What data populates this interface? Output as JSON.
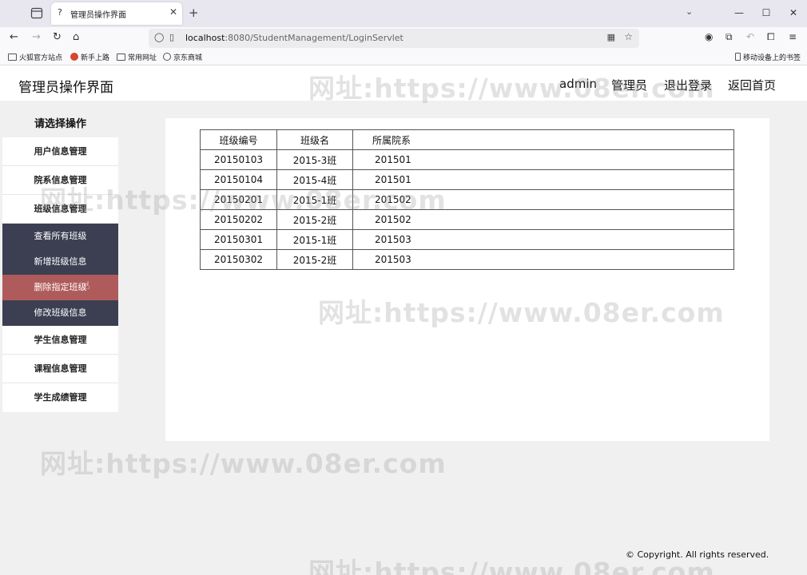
{
  "browser": {
    "tab_title": "管理员操作界面",
    "tab_favicon": "?",
    "url_host": "localhost",
    "url_rest": ":8080/StudentManagement/LoginServlet",
    "bookmarks": [
      "火狐官方站点",
      "新手上路",
      "常用网址",
      "京东商城"
    ],
    "mobile_bookmarks": "移动设备上的书签"
  },
  "header": {
    "title": "管理员操作界面",
    "user": "admin",
    "role": "管理员",
    "logout": "退出登录",
    "home": "返回首页"
  },
  "sidebar": {
    "heading": "请选择操作",
    "items": [
      "用户信息管理",
      "院系信息管理",
      "班级信息管理"
    ],
    "subitems": [
      "查看所有班级",
      "新增班级信息",
      "删除指定班级",
      "修改班级信息"
    ],
    "items_after": [
      "学生信息管理",
      "课程信息管理",
      "学生成绩管理"
    ]
  },
  "table": {
    "headers": [
      "班级编号",
      "班级名",
      "所属院系"
    ],
    "rows": [
      [
        "20150103",
        "2015-3班",
        "201501"
      ],
      [
        "20150104",
        "2015-4班",
        "201501"
      ],
      [
        "20150201",
        "2015-1班",
        "201502"
      ],
      [
        "20150202",
        "2015-2班",
        "201502"
      ],
      [
        "20150301",
        "2015-1班",
        "201503"
      ],
      [
        "20150302",
        "2015-2班",
        "201503"
      ]
    ]
  },
  "footer": {
    "copyright": "© Copyright. All rights reserved."
  },
  "watermark": "网址:https://www.08er.com",
  "colors": {
    "submenu_bg": "#3c3f52",
    "submenu_active": "#b05b5b"
  }
}
